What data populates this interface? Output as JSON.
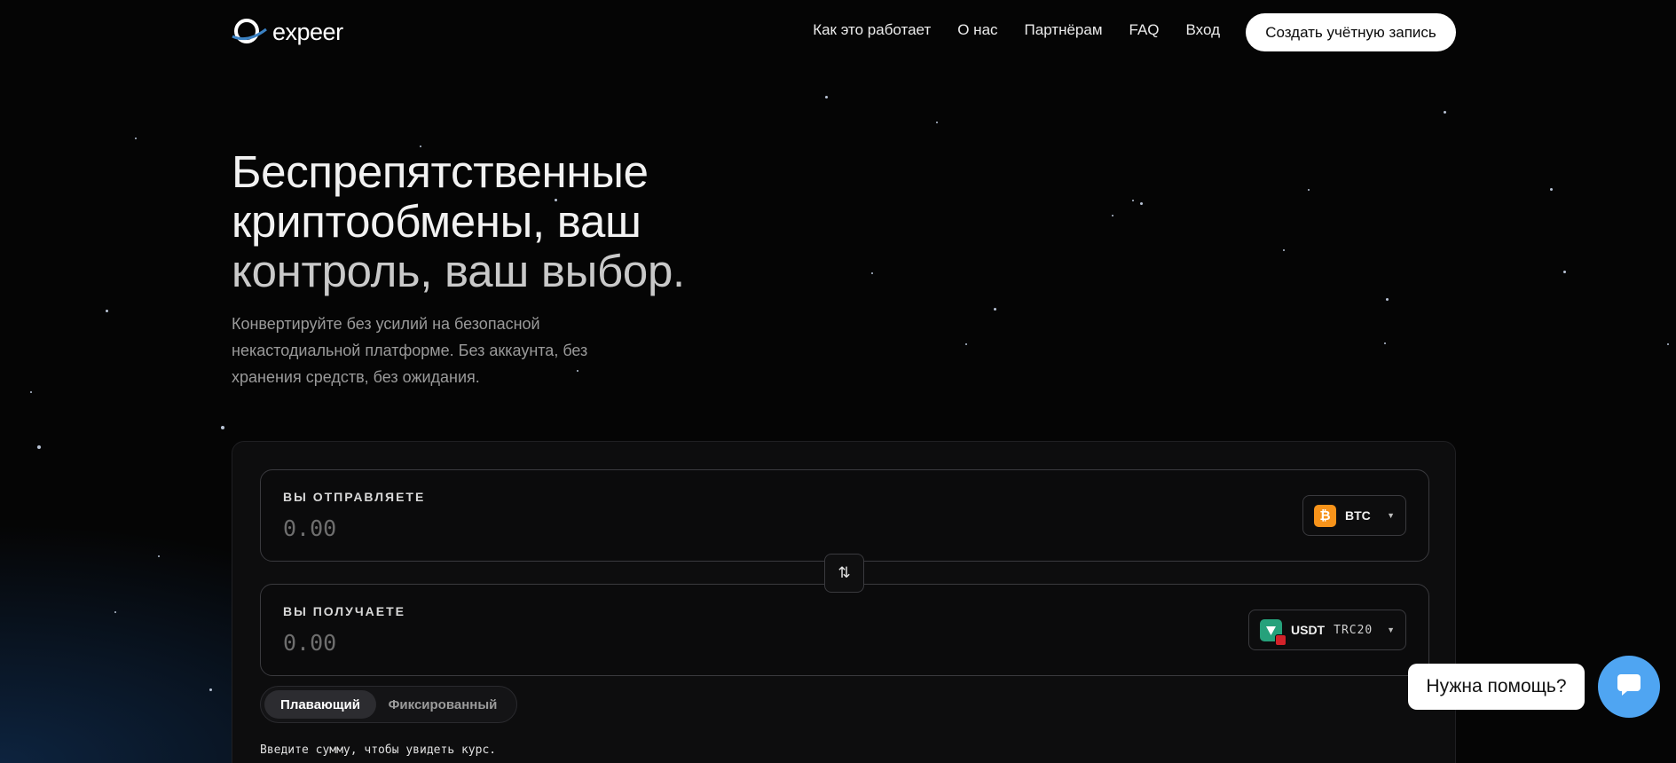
{
  "header": {
    "logo_text": "expeer",
    "nav": [
      "Как это работает",
      "О нас",
      "Партнёрам",
      "FAQ",
      "Вход"
    ],
    "cta_label": "Создать учётную запись"
  },
  "hero": {
    "title_lines": [
      "Беспрепятственные",
      "криптообмены, ваш",
      "контроль, ваш выбор."
    ],
    "subtitle": "Конвертируйте без усилий на безопасной некастодиальной платформе. Без аккаунта, без хранения средств, без ожидания."
  },
  "exchange": {
    "send": {
      "label": "ВЫ ОТПРАВЛЯЕТЕ",
      "placeholder": "0.00",
      "coin": "BTC"
    },
    "receive": {
      "label": "ВЫ ПОЛУЧАЕТЕ",
      "placeholder": "0.00",
      "coin": "USDT",
      "network": "TRC20"
    },
    "rate_modes": [
      "Плавающий",
      "Фиксированный"
    ],
    "active_mode": "Плавающий",
    "rate_hint": "Введите сумму, чтобы увидеть курс."
  },
  "help": {
    "bubble_text": "Нужна помощь?"
  },
  "colors": {
    "accent": "#4fa5f2",
    "btc": "#f7931a",
    "usdt": "#26a17b"
  },
  "icons": [
    "logo-icon",
    "swap-arrows-icon",
    "bitcoin-icon",
    "tether-icon",
    "tron-badge-icon",
    "chevron-down-icon",
    "chat-icon"
  ]
}
